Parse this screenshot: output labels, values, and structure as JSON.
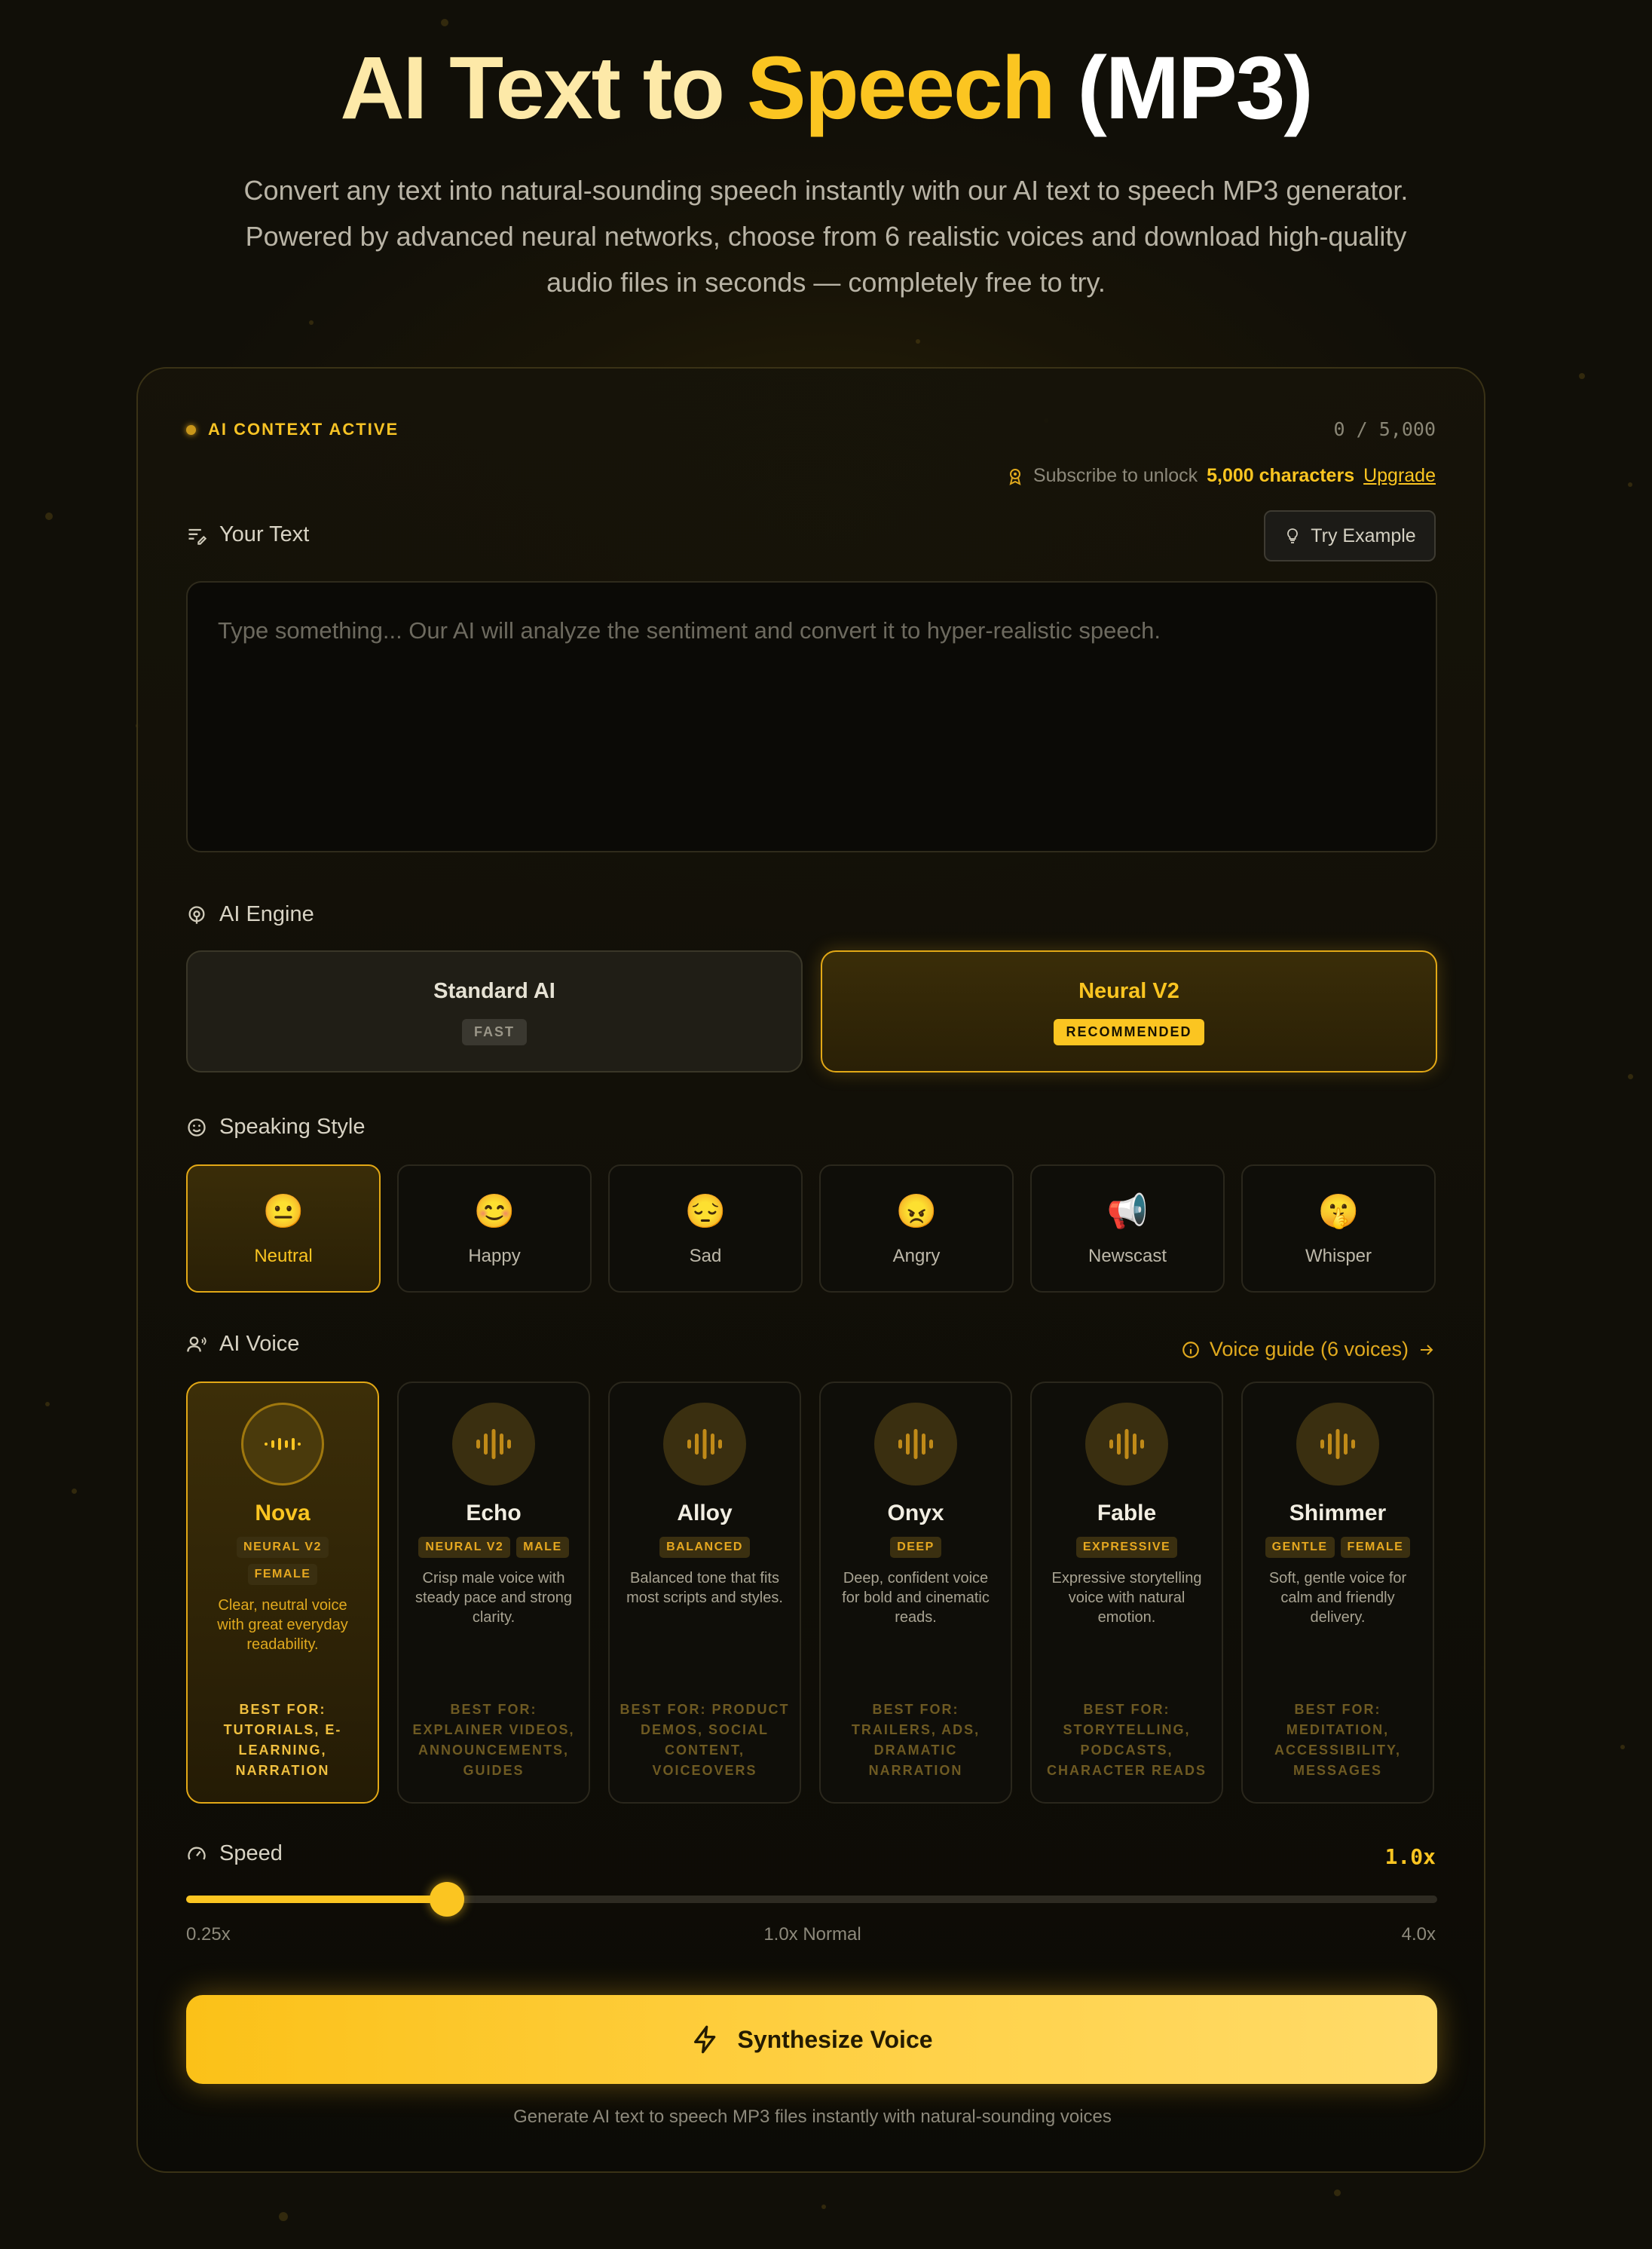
{
  "hero": {
    "title_part1": "AI Text to ",
    "title_part2": "Speech",
    "title_part3": " (MP3)",
    "subtitle": "Convert any text into natural-sounding speech instantly with our AI text to speech MP3 generator. Powered by advanced neural networks, choose from 6 realistic voices and download high-quality audio files in seconds — completely free to try."
  },
  "status": {
    "context_label": "AI CONTEXT ACTIVE",
    "char_count": "0 / 5,000"
  },
  "subscribe": {
    "prefix": "Subscribe to unlock",
    "highlight": "5,000 characters",
    "link": "Upgrade"
  },
  "text_section": {
    "label": "Your Text",
    "example_button": "Try Example",
    "placeholder": "Type something... Our AI will analyze the sentiment and convert it to hyper-realistic speech."
  },
  "engine": {
    "label": "AI Engine",
    "options": [
      {
        "name": "Standard AI",
        "badge": "FAST",
        "selected": false
      },
      {
        "name": "Neural V2",
        "badge": "RECOMMENDED",
        "selected": true
      }
    ]
  },
  "style": {
    "label": "Speaking Style",
    "options": [
      {
        "emoji": "😐",
        "name": "Neutral",
        "selected": true
      },
      {
        "emoji": "😊",
        "name": "Happy",
        "selected": false
      },
      {
        "emoji": "😔",
        "name": "Sad",
        "selected": false
      },
      {
        "emoji": "😠",
        "name": "Angry",
        "selected": false
      },
      {
        "emoji": "📢",
        "name": "Newscast",
        "selected": false
      },
      {
        "emoji": "🤫",
        "name": "Whisper",
        "selected": false
      }
    ]
  },
  "voice": {
    "label": "AI Voice",
    "guide_link": "Voice guide (6 voices)",
    "options": [
      {
        "name": "Nova",
        "tags": [
          "NEURAL V2",
          "FEMALE"
        ],
        "desc": "Clear, neutral voice with great everyday readability.",
        "best": "BEST FOR: TUTORIALS, E-LEARNING, NARRATION",
        "selected": true
      },
      {
        "name": "Echo",
        "tags": [
          "NEURAL V2",
          "MALE"
        ],
        "desc": "Crisp male voice with steady pace and strong clarity.",
        "best": "BEST FOR: EXPLAINER VIDEOS, ANNOUNCEMENTS, GUIDES",
        "selected": false
      },
      {
        "name": "Alloy",
        "tags": [
          "BALANCED"
        ],
        "desc": "Balanced tone that fits most scripts and styles.",
        "best": "BEST FOR: PRODUCT DEMOS, SOCIAL CONTENT, VOICEOVERS",
        "selected": false
      },
      {
        "name": "Onyx",
        "tags": [
          "DEEP"
        ],
        "desc": "Deep, confident voice for bold and cinematic reads.",
        "best": "BEST FOR: TRAILERS, ADS, DRAMATIC NARRATION",
        "selected": false
      },
      {
        "name": "Fable",
        "tags": [
          "EXPRESSIVE"
        ],
        "desc": "Expressive storytelling voice with natural emotion.",
        "best": "BEST FOR: STORYTELLING, PODCASTS, CHARACTER READS",
        "selected": false
      },
      {
        "name": "Shimmer",
        "tags": [
          "GENTLE",
          "FEMALE"
        ],
        "desc": "Soft, gentle voice for calm and friendly delivery.",
        "best": "BEST FOR: MEDITATION, ACCESSIBILITY, MESSAGES",
        "selected": false
      }
    ]
  },
  "speed": {
    "label": "Speed",
    "value": "1.0x",
    "min_label": "0.25x",
    "mid_label": "1.0x Normal",
    "max_label": "4.0x",
    "fraction": 0.2
  },
  "action": {
    "button": "Synthesize Voice",
    "footnote": "Generate AI text to speech MP3 files instantly with natural-sounding voices"
  },
  "colors": {
    "accent": "#fbc521",
    "background": "#110f08"
  }
}
